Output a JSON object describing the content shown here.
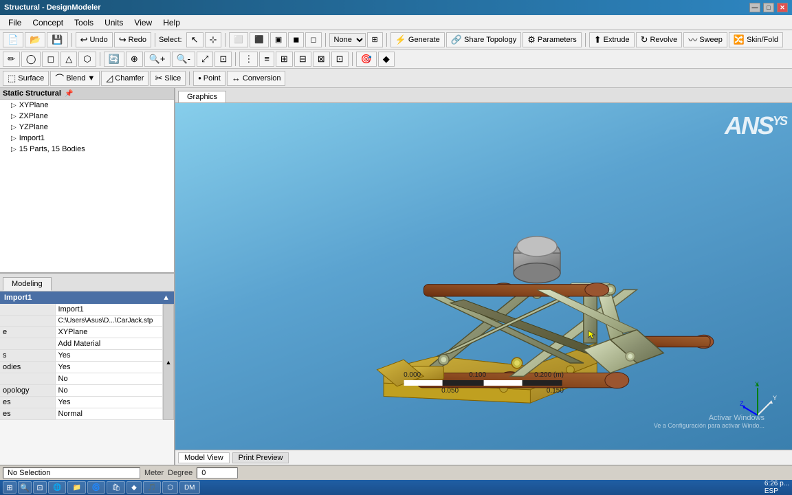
{
  "titlebar": {
    "title": "Structural - DesignModeler",
    "controls": [
      "—",
      "□",
      "✕"
    ]
  },
  "menubar": {
    "items": [
      "File",
      "Concept",
      "Tools",
      "Units",
      "View",
      "Help"
    ]
  },
  "toolbar1": {
    "undo_label": "Undo",
    "redo_label": "Redo",
    "select_label": "Select:",
    "none_option": "None",
    "generate_label": "Generate",
    "share_topology_label": "Share Topology",
    "parameters_label": "Parameters"
  },
  "toolbar2": {
    "extrude_label": "Extrude",
    "revolve_label": "Revolve",
    "sweep_label": "Sweep",
    "skinfold_label": "Skin/Fold"
  },
  "toolbar3": {
    "surface_label": "Surface",
    "blend_label": "Blend",
    "chamfer_label": "Chamfer",
    "slice_label": "Slice",
    "point_label": "Point",
    "conversion_label": "Conversion"
  },
  "graphics_tabs": {
    "tabs": [
      "Graphics"
    ]
  },
  "bottom_tabs": {
    "tabs": [
      "Model View",
      "Print Preview"
    ]
  },
  "tree": {
    "header": "Static Structural",
    "items": [
      {
        "label": "XYPlane",
        "icon": "▷",
        "indent": 0
      },
      {
        "label": "ZXPlane",
        "icon": "▷",
        "indent": 0
      },
      {
        "label": "YZPlane",
        "icon": "▷",
        "indent": 0
      },
      {
        "label": "Import1",
        "icon": "▷",
        "indent": 0
      },
      {
        "label": "15 Parts, 15 Bodies",
        "icon": "▷",
        "indent": 0
      }
    ]
  },
  "modeling_tab": "Modeling",
  "props": {
    "header": "Import1",
    "rows": [
      {
        "key": "",
        "value": "Import1"
      },
      {
        "key": "",
        "value": "C:\\Users\\Asus\\D...\\CarJack.stp"
      },
      {
        "key": "e",
        "value": "XYPlane"
      },
      {
        "key": "",
        "value": "Add Material"
      },
      {
        "key": "s",
        "value": "Yes"
      },
      {
        "key": "odies",
        "value": "Yes"
      },
      {
        "key": "",
        "value": "No"
      },
      {
        "key": "opology",
        "value": "No"
      },
      {
        "key": "es",
        "value": "Yes"
      },
      {
        "key": "es",
        "value": "Normal"
      }
    ]
  },
  "statusbar": {
    "selection_label": "No Selection",
    "unit1_label": "Meter",
    "unit2_label": "Degree",
    "value": "0"
  },
  "ansys_logo": "ANS",
  "scale": {
    "marks": [
      "0.000",
      "0.100",
      "0.200 (m)",
      "0.050",
      "0.150"
    ]
  },
  "watermark": {
    "line1": "Activar Windows",
    "line2": "Ve a Configuración para activar Windo..."
  },
  "taskbar": {
    "time": "6:26 p...",
    "lang": "ESP",
    "icons": [
      "⊞",
      "⊙",
      "📁",
      "🌐",
      "📄",
      "🔔",
      "🎵",
      "🔷",
      "◆",
      "⬟"
    ]
  }
}
